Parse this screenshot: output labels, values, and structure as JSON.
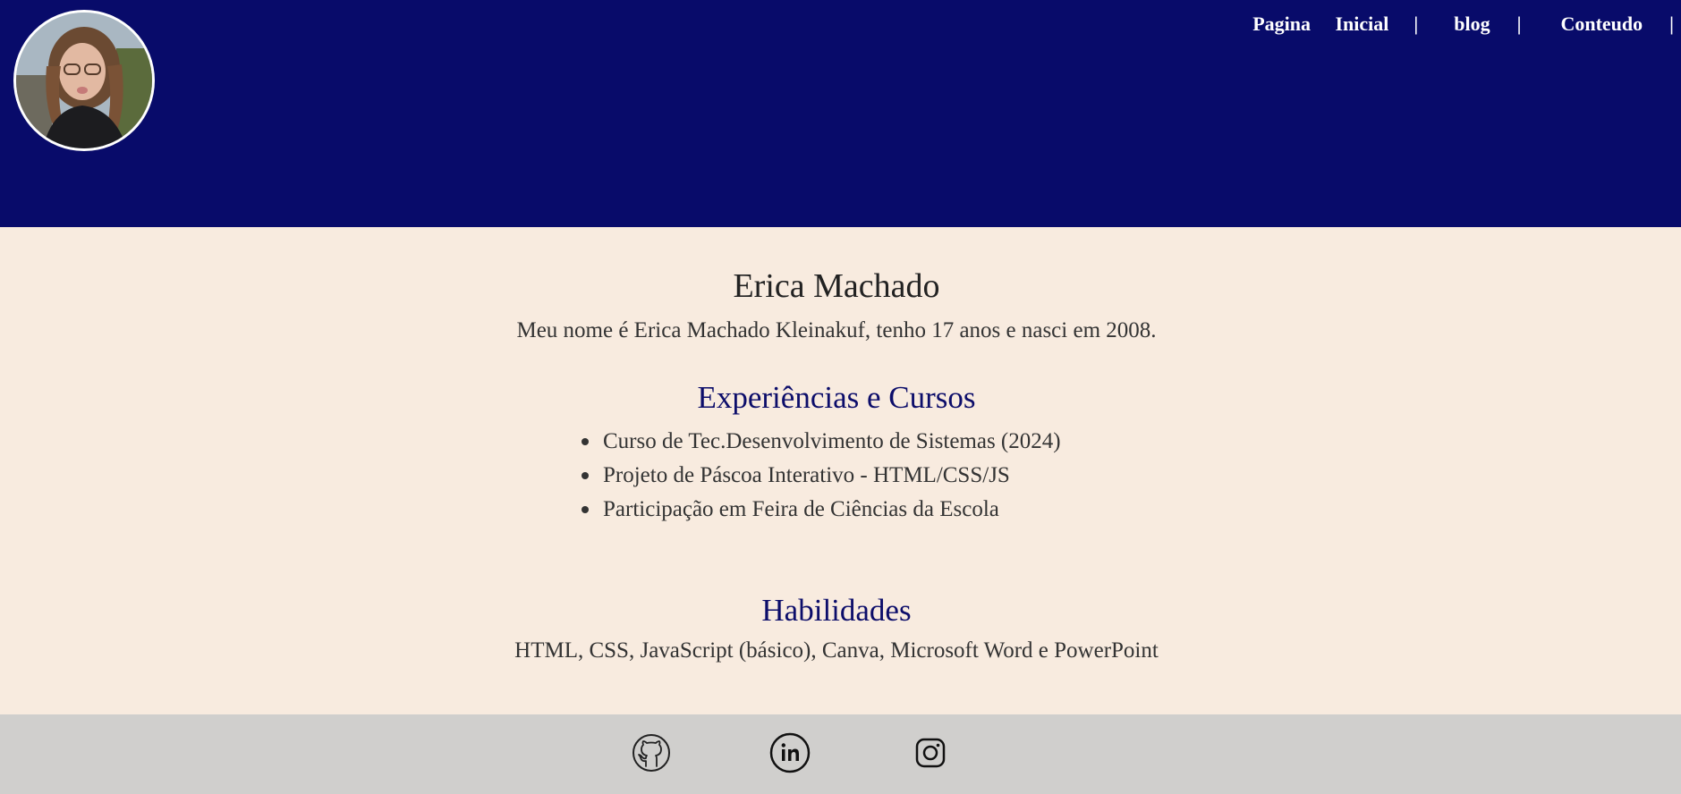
{
  "header": {
    "nav": [
      {
        "label": "Pagina Inicial"
      },
      {
        "label": "blog"
      },
      {
        "label": "Conteudo"
      }
    ],
    "separator": "|",
    "avatar_alt": "Erica Machado",
    "background_color": "#080b6a"
  },
  "profile": {
    "name": "Erica Machado",
    "intro": "Meu nome é Erica Machado Kleinakuf, tenho 17 anos e nasci em 2008."
  },
  "experience": {
    "heading": "Experiências e Cursos",
    "items": [
      "Curso de Tec.Desenvolvimento de Sistemas (2024)",
      "Projeto de Páscoa Interativo - HTML/CSS/JS",
      "Participação em Feira de Ciências da Escola"
    ]
  },
  "skills": {
    "heading": "Habilidades",
    "text": "HTML, CSS, JavaScript (básico), Canva, Microsoft Word e PowerPoint"
  },
  "footer": {
    "icons": [
      "github-icon",
      "linkedin-icon",
      "instagram-icon"
    ],
    "background_color": "#d0cfcd"
  },
  "colors": {
    "page_background": "#f8ebdf",
    "heading_accent": "#0c0d6a"
  }
}
